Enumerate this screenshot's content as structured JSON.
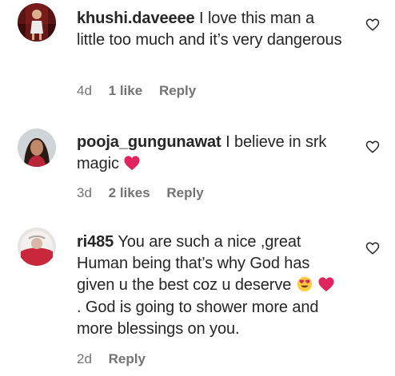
{
  "comments": [
    {
      "username": "khushi.daveeee",
      "text": "I love this man a little too much and it’s very dangerous",
      "time": "4d",
      "likes": "1 like",
      "reply": "Reply",
      "avatar_icon": "profile-photo"
    },
    {
      "username": "pooja_gungunawat",
      "text": "I believe in srk magic",
      "time": "3d",
      "likes": "2 likes",
      "reply": "Reply",
      "avatar_icon": "profile-photo",
      "emoji": "red-heart"
    },
    {
      "username": "ri485",
      "text_part1": "You are such a nice ,great Human being that’s why God has given u the best coz u deserve",
      "text_part2": ". God is going to shower more and more blessings on you.",
      "time": "2d",
      "reply": "Reply",
      "avatar_icon": "profile-photo",
      "emojis": [
        "heart-eyes-face",
        "red-heart"
      ]
    }
  ],
  "colors": {
    "text": "#262626",
    "meta": "#737373",
    "heart": "#e0245e"
  }
}
